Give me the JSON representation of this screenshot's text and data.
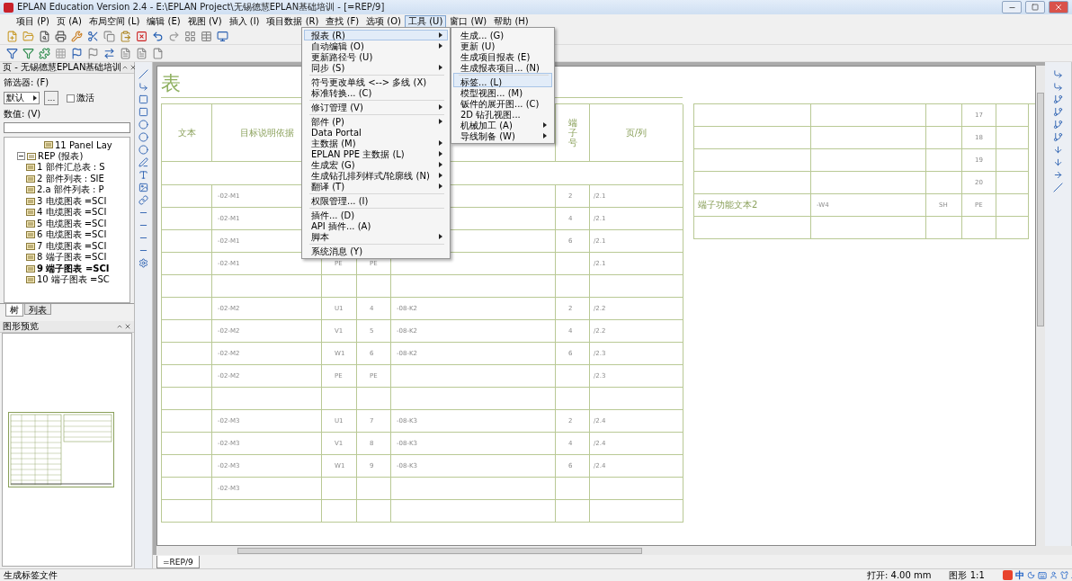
{
  "window": {
    "title": "EPLAN Education Version 2.4 - E:\\EPLAN Project\\无锡德慧EPLAN基础培训 - [=REP/9]"
  },
  "menu_bar": [
    {
      "label": "项目 (P)",
      "selected": false
    },
    {
      "label": "页 (A)",
      "selected": false
    },
    {
      "label": "布局空间 (L)",
      "selected": false
    },
    {
      "label": "编辑 (E)",
      "selected": false
    },
    {
      "label": "视图 (V)",
      "selected": false
    },
    {
      "label": "插入 (I)",
      "selected": false
    },
    {
      "label": "项目数据 (R)",
      "selected": false
    },
    {
      "label": "查找 (F)",
      "selected": false
    },
    {
      "label": "选项 (O)",
      "selected": false
    },
    {
      "label": "工具 (U)",
      "selected": true
    },
    {
      "label": "窗口 (W)",
      "selected": false
    },
    {
      "label": "帮助 (H)",
      "selected": false
    }
  ],
  "tools_menu": [
    {
      "label": "报表 (R)",
      "submenu": true,
      "selected": true,
      "separator_before": false
    },
    {
      "label": "自动编辑 (O)",
      "submenu": true,
      "selected": false,
      "separator_before": false
    },
    {
      "label": "更新路径号 (U)",
      "submenu": false,
      "selected": false,
      "separator_before": false
    },
    {
      "label": "同步 (S)",
      "submenu": true,
      "selected": false,
      "separator_before": false
    },
    {
      "label": "符号更改单线 <--> 多线 (X)",
      "submenu": false,
      "selected": false,
      "separator_before": true
    },
    {
      "label": "标准转换... (C)",
      "submenu": false,
      "selected": false,
      "separator_before": false
    },
    {
      "label": "修订管理 (V)",
      "submenu": true,
      "selected": false,
      "separator_before": true
    },
    {
      "label": "部件 (P)",
      "submenu": true,
      "selected": false,
      "separator_before": true
    },
    {
      "label": "Data Portal",
      "submenu": false,
      "selected": false,
      "separator_before": false
    },
    {
      "label": "主数据 (M)",
      "submenu": true,
      "selected": false,
      "separator_before": false
    },
    {
      "label": "EPLAN PPE 主数据 (L)",
      "submenu": true,
      "selected": false,
      "separator_before": false
    },
    {
      "label": "生成宏 (G)",
      "submenu": true,
      "selected": false,
      "separator_before": false
    },
    {
      "label": "生成钻孔排列样式/轮廓线 (N)",
      "submenu": true,
      "selected": false,
      "separator_before": false
    },
    {
      "label": "翻译 (T)",
      "submenu": true,
      "selected": false,
      "separator_before": false
    },
    {
      "label": "权限管理... (I)",
      "submenu": false,
      "selected": false,
      "separator_before": true
    },
    {
      "label": "插件... (D)",
      "submenu": false,
      "selected": false,
      "separator_before": true
    },
    {
      "label": "API 插件... (A)",
      "submenu": false,
      "selected": false,
      "separator_before": false
    },
    {
      "label": "脚本",
      "submenu": true,
      "selected": false,
      "separator_before": false
    },
    {
      "label": "系统消息 (Y)",
      "submenu": false,
      "selected": false,
      "separator_before": true
    }
  ],
  "reports_submenu": [
    {
      "label": "生成... (G)",
      "submenu": false,
      "selected": false,
      "separator_before": false
    },
    {
      "label": "更新 (U)",
      "submenu": false,
      "selected": false,
      "separator_before": false
    },
    {
      "label": "生成项目报表 (E)",
      "submenu": false,
      "selected": false,
      "separator_before": false
    },
    {
      "label": "生成报表项目... (N)",
      "submenu": false,
      "selected": false,
      "separator_before": false
    },
    {
      "label": "标签... (L)",
      "submenu": false,
      "selected": true,
      "separator_before": true
    },
    {
      "label": "模型视图... (M)",
      "submenu": false,
      "selected": false,
      "separator_before": false
    },
    {
      "label": "钣件的展开图... (C)",
      "submenu": false,
      "selected": false,
      "separator_before": false
    },
    {
      "label": "2D 钻孔视图...",
      "submenu": false,
      "selected": false,
      "separator_before": false
    },
    {
      "label": "机械加工 (A)",
      "submenu": true,
      "selected": false,
      "separator_before": false
    },
    {
      "label": "导线制备 (W)",
      "submenu": true,
      "selected": false,
      "separator_before": false
    }
  ],
  "page_navigator": {
    "title": "页 - 无锡德慧EPLAN基础培训",
    "filter_label": "筛选器: (F)",
    "filter_value": "默认",
    "more_button": "...",
    "activate": {
      "label": "激活",
      "checked": false
    },
    "value_label": "数值: (V)",
    "tree": [
      {
        "label": "11 Panel Lay",
        "selected": false
      },
      {
        "label": "REP (报表)",
        "selected": false,
        "expanded": true,
        "children": [
          {
            "label": "1 部件汇总表 : S",
            "selected": false
          },
          {
            "label": "2 部件列表 : SIE",
            "selected": false
          },
          {
            "label": "2.a 部件列表 : P",
            "selected": false
          },
          {
            "label": "3 电缆图表 =SCI",
            "selected": false
          },
          {
            "label": "4 电缆图表 =SCI",
            "selected": false
          },
          {
            "label": "5 电缆图表 =SCI",
            "selected": false
          },
          {
            "label": "6 电缆图表 =SCI",
            "selected": false
          },
          {
            "label": "7 电缆图表 =SCI",
            "selected": false
          },
          {
            "label": "8 端子图表 =SCI",
            "selected": false
          },
          {
            "label": "9 端子图表 =SCI",
            "selected": true
          },
          {
            "label": "10 端子图表 =SC",
            "selected": false
          }
        ]
      }
    ],
    "tabs": [
      {
        "label": "树",
        "selected": true
      },
      {
        "label": "列表",
        "selected": false
      }
    ]
  },
  "preview": {
    "title": "图形预览"
  },
  "sheet": {
    "title": "表",
    "left_table": {
      "headers": {
        "column_1": "文本",
        "column_2": "目标说明依据",
        "column_6": "端子号",
        "column_7": "页/列"
      },
      "rows": [
        {
          "kind": "entry",
          "column_2": "-02-M1",
          "column_6": "2",
          "column_7": "/2.1"
        },
        {
          "kind": "entry",
          "column_2": "-02-M1",
          "column_6": "4",
          "column_7": "/2.1"
        },
        {
          "kind": "entry",
          "column_2": "-02-M1",
          "column_6": "6",
          "column_7": "/2.1"
        },
        {
          "kind": "entry",
          "column_2": "-02-M1",
          "column_3": "PE",
          "column_4": "PE",
          "column_7": "/2.1"
        },
        {
          "kind": "blank"
        },
        {
          "kind": "entry",
          "column_2": "-02-M2",
          "column_3": "U1",
          "column_4": "4",
          "column_5": "-08-K2",
          "column_6": "2",
          "column_7": "/2.2"
        },
        {
          "kind": "entry",
          "column_2": "-02-M2",
          "column_3": "V1",
          "column_4": "5",
          "column_5": "-08-K2",
          "column_6": "4",
          "column_7": "/2.2"
        },
        {
          "kind": "entry",
          "column_2": "-02-M2",
          "column_3": "W1",
          "column_4": "6",
          "column_5": "-08-K2",
          "column_6": "6",
          "column_7": "/2.3"
        },
        {
          "kind": "entry",
          "column_2": "-02-M2",
          "column_3": "PE",
          "column_4": "PE",
          "column_7": "/2.3"
        },
        {
          "kind": "blank"
        },
        {
          "kind": "entry",
          "column_2": "-02-M3",
          "column_3": "U1",
          "column_4": "7",
          "column_5": "-08-K3",
          "column_6": "2",
          "column_7": "/2.4"
        },
        {
          "kind": "entry",
          "column_2": "-02-M3",
          "column_3": "V1",
          "column_4": "8",
          "column_5": "-08-K3",
          "column_6": "4",
          "column_7": "/2.4"
        },
        {
          "kind": "entry",
          "column_2": "-02-M3",
          "column_3": "W1",
          "column_4": "9",
          "column_5": "-08-K3",
          "column_6": "6",
          "column_7": "/2.4"
        },
        {
          "kind": "entry",
          "column_2": "-02-M3"
        },
        {
          "kind": "blank"
        }
      ]
    },
    "right_table": {
      "rows": [
        {
          "kind": "entry",
          "column_4": "17"
        },
        {
          "kind": "entry",
          "column_4": "18"
        },
        {
          "kind": "entry",
          "column_4": "19"
        },
        {
          "kind": "entry",
          "column_4": "20"
        },
        {
          "kind": "entry",
          "column_1": "端子功能文本2",
          "column_2": "-W4",
          "column_3": "SH",
          "column_4": "PE"
        },
        {
          "kind": "blank"
        }
      ]
    }
  },
  "document_tabs": [
    {
      "label": "=REP/9",
      "selected": true
    }
  ],
  "status_bar": {
    "message": "生成标签文件",
    "snap": "打开: 4.00 mm",
    "scale": "图形 1:1",
    "ime": "中"
  }
}
